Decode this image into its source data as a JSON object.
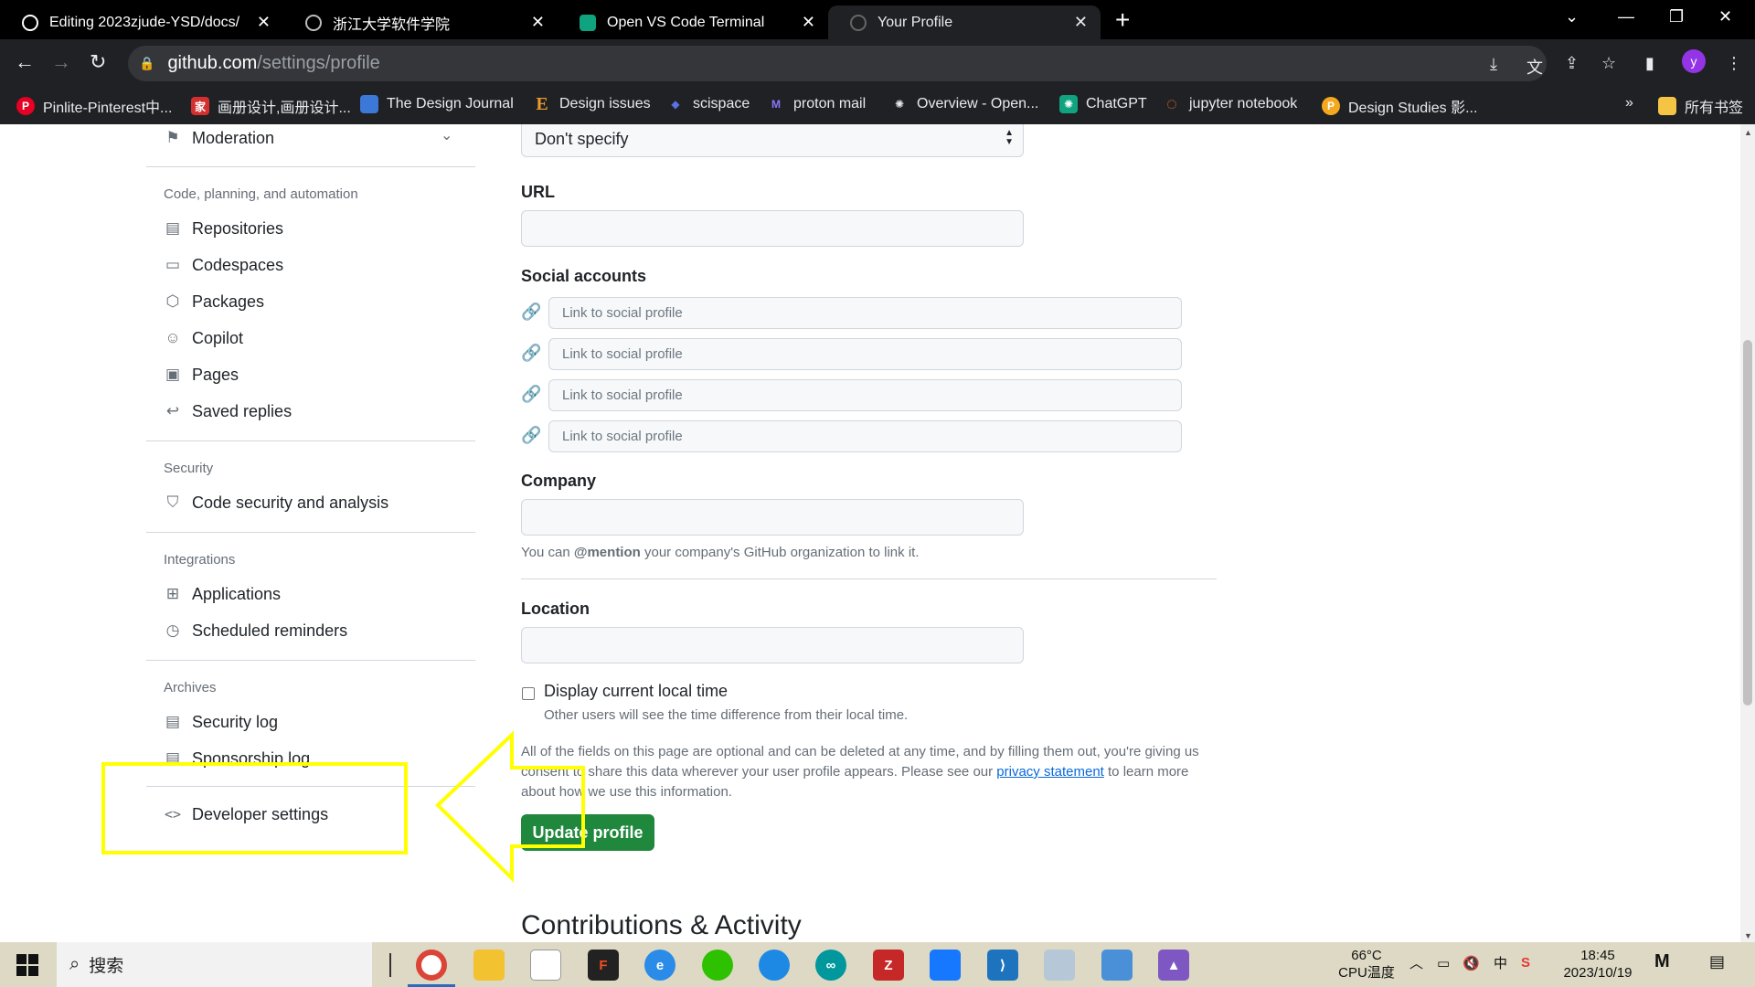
{
  "browser": {
    "tabs": [
      {
        "title": "Editing 2023zjude-YSD/docs/",
        "icon": "github-icon",
        "active": false
      },
      {
        "title": "浙江大学软件学院",
        "icon": "globe-icon",
        "active": false
      },
      {
        "title": "Open VS Code Terminal",
        "icon": "chatgpt-icon",
        "active": false
      },
      {
        "title": "Your Profile",
        "icon": "github-icon",
        "active": true
      }
    ],
    "url_host": "github.com",
    "url_path": "/settings/profile",
    "profile_initial": "y",
    "bookmarks": [
      {
        "label": "Pinlite-Pinterest中...",
        "icon": "pinterest-icon",
        "color": "#e60023"
      },
      {
        "label": "画册设计,画册设计...",
        "icon": "home-icon",
        "color": "#d32f2f"
      },
      {
        "label": "The Design Journal",
        "icon": "book-icon",
        "color": "#3b78d8"
      },
      {
        "label": "Design issues",
        "icon": "e-icon",
        "color": "#e89a2c"
      },
      {
        "label": "scispace",
        "icon": "layers-icon",
        "color": "#5b6fe6"
      },
      {
        "label": "proton mail",
        "icon": "mail-icon",
        "color": "#6d4aff"
      },
      {
        "label": "Overview - Open...",
        "icon": "openai-icon",
        "color": "#444"
      },
      {
        "label": "ChatGPT",
        "icon": "chatgpt-icon",
        "color": "#10a37f"
      },
      {
        "label": "jupyter notebook",
        "icon": "jupyter-icon",
        "color": "#f37626"
      },
      {
        "label": "Design Studies 影...",
        "icon": "p-icon",
        "color": "#f4a81d"
      }
    ],
    "bookmarks_overflow": "»",
    "all_bookmarks_label": "所有书签"
  },
  "sidebar": {
    "top_item": "Moderation",
    "sections": [
      {
        "heading": "Code, planning, and automation",
        "items": [
          "Repositories",
          "Codespaces",
          "Packages",
          "Copilot",
          "Pages",
          "Saved replies"
        ]
      },
      {
        "heading": "Security",
        "items": [
          "Code security and analysis"
        ]
      },
      {
        "heading": "Integrations",
        "items": [
          "Applications",
          "Scheduled reminders"
        ]
      },
      {
        "heading": "Archives",
        "items": [
          "Security log",
          "Sponsorship log"
        ]
      }
    ],
    "developer_settings": "Developer settings"
  },
  "form": {
    "pronouns_value": "Don't specify",
    "url_label": "URL",
    "url_value": "",
    "social_label": "Social accounts",
    "social_placeholder": "Link to social profile",
    "company_label": "Company",
    "company_value": "",
    "company_note_prefix": "You can ",
    "company_note_mention": "@mention",
    "company_note_suffix": " your company's GitHub organization to link it.",
    "location_label": "Location",
    "location_value": "",
    "local_time_label": "Display current local time",
    "local_time_checked": false,
    "local_time_note": "Other users will see the time difference from their local time.",
    "privacy_text_before": "All of the fields on this page are optional and can be deleted at any time, and by filling them out, you're giving us consent to share this data wherever your user profile appears. Please see our ",
    "privacy_link": "privacy statement",
    "privacy_text_after": " to learn more about how we use this information.",
    "update_button": "Update profile",
    "next_heading": "Contributions & Activity"
  },
  "annotation": {
    "color": "#ffff00",
    "target": "Developer settings"
  },
  "taskbar": {
    "search_label": "搜索",
    "temp": "66°C",
    "temp_label": "CPU温度",
    "ime": "中",
    "time": "18:45",
    "date": "2023/10/19"
  }
}
